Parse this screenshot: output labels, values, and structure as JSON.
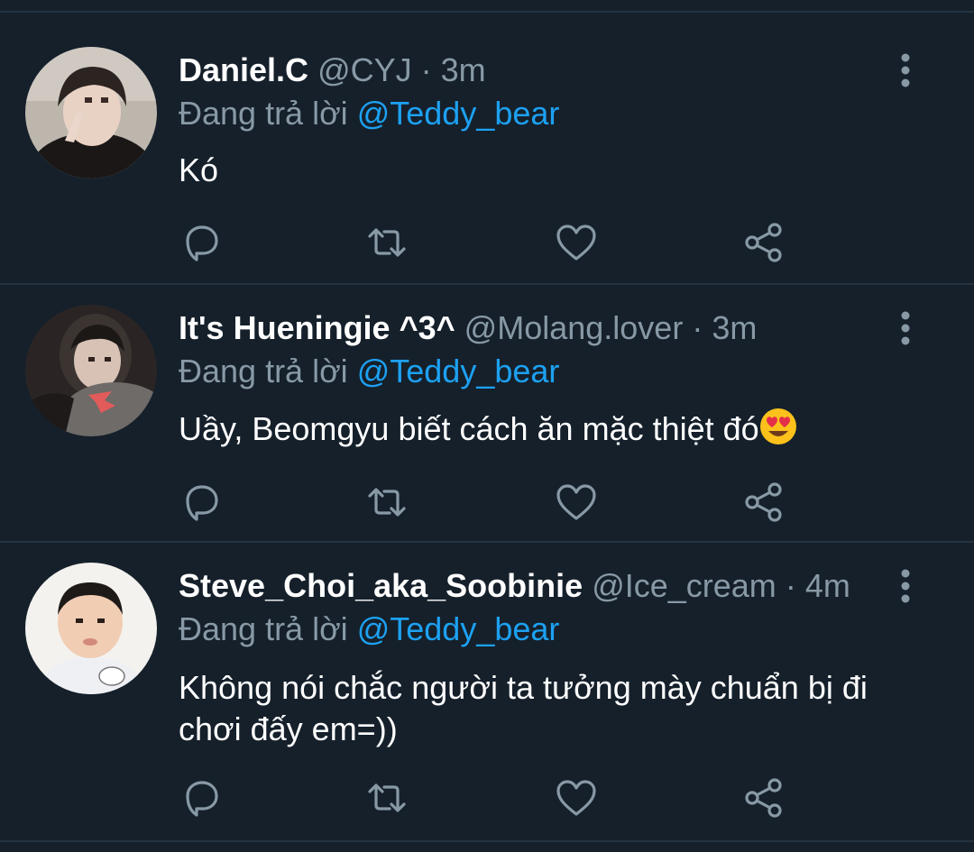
{
  "colors": {
    "background": "#15202b",
    "divider": "#253341",
    "secondary_text": "#8899a6",
    "link": "#1da1f2"
  },
  "icons": [
    "reply-icon",
    "retweet-icon",
    "like-icon",
    "share-icon",
    "more-vertical-icon",
    "heart-eyes-emoji"
  ],
  "tweets": [
    {
      "name": "Daniel.C",
      "handle": "@CYJ",
      "separator": "·",
      "time": "3m",
      "reply_prefix": "Đang trả lời",
      "reply_to": "@Teddy_bear",
      "text": "Kó"
    },
    {
      "name": "It's Hueningie ^3^",
      "handle": "@Molang.lover",
      "separator": "·",
      "time": "3m",
      "reply_prefix": "Đang trả lời",
      "reply_to": "@Teddy_bear",
      "text": "Uầy, Beomgyu biết cách ăn mặc thiệt đó"
    },
    {
      "name": "Steve_Choi_aka_Soobinie",
      "handle": "@Ice_cream",
      "separator": "·",
      "time": "4m",
      "reply_prefix": "Đang trả lời",
      "reply_to": "@Teddy_bear",
      "text": "Không nói chắc người ta tưởng mày chuẩn bị đi chơi đấy em=))"
    }
  ]
}
